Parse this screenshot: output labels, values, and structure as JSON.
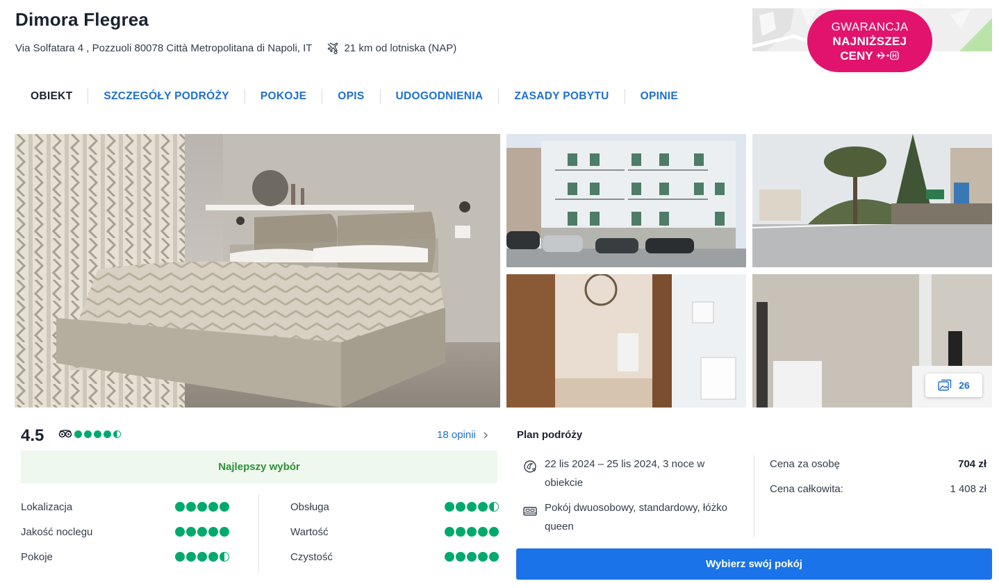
{
  "hotel": {
    "name": "Dimora Flegrea",
    "address": "Via Solfatara 4 , Pozzuoli 80078 Città Metropolitana di Napoli, IT",
    "airport_distance": "21 km od lotniska (NAP)"
  },
  "badge": {
    "line1": "GWARANCJA",
    "line2": "NAJNIŻSZEJ",
    "line3": "CENY",
    "color": "#e1136d"
  },
  "nav": {
    "items": [
      "OBIEKT",
      "SZCZEGÓŁY PODRÓŻY",
      "POKOJE",
      "OPIS",
      "UDOGODNIENIA",
      "ZASADY POBYTU",
      "OPINIE"
    ]
  },
  "gallery": {
    "photo_count": "26"
  },
  "rating": {
    "score": "4.5",
    "tripadvisor_bubbles": 4.5,
    "reviews_link": "18 opinii",
    "badge": "Najlepszy wybór",
    "categories_left": [
      {
        "label": "Lokalizacja",
        "value": 5
      },
      {
        "label": "Jakość noclegu",
        "value": 5
      },
      {
        "label": "Pokoje",
        "value": 4.5
      }
    ],
    "categories_right": [
      {
        "label": "Obsługa",
        "value": 4.5
      },
      {
        "label": "Wartość",
        "value": 5
      },
      {
        "label": "Czystość",
        "value": 5
      }
    ]
  },
  "plan": {
    "title": "Plan podróży",
    "dates": "22 lis 2024 – 25 lis 2024, 3 noce w obiekcie",
    "room": "Pokój dwuosobowy, standardowy, łóżko queen",
    "price_per_person_label": "Cena za osobę",
    "price_per_person": "704 zł",
    "total_label": "Cena całkowita:",
    "total": "1 408 zł",
    "cta": "Wybierz swój pokój"
  },
  "colors": {
    "accent": "#1a73e8",
    "link": "#1d6fd1",
    "rating_green": "#00aa6c",
    "best_choice_bg": "#eef8ee"
  }
}
